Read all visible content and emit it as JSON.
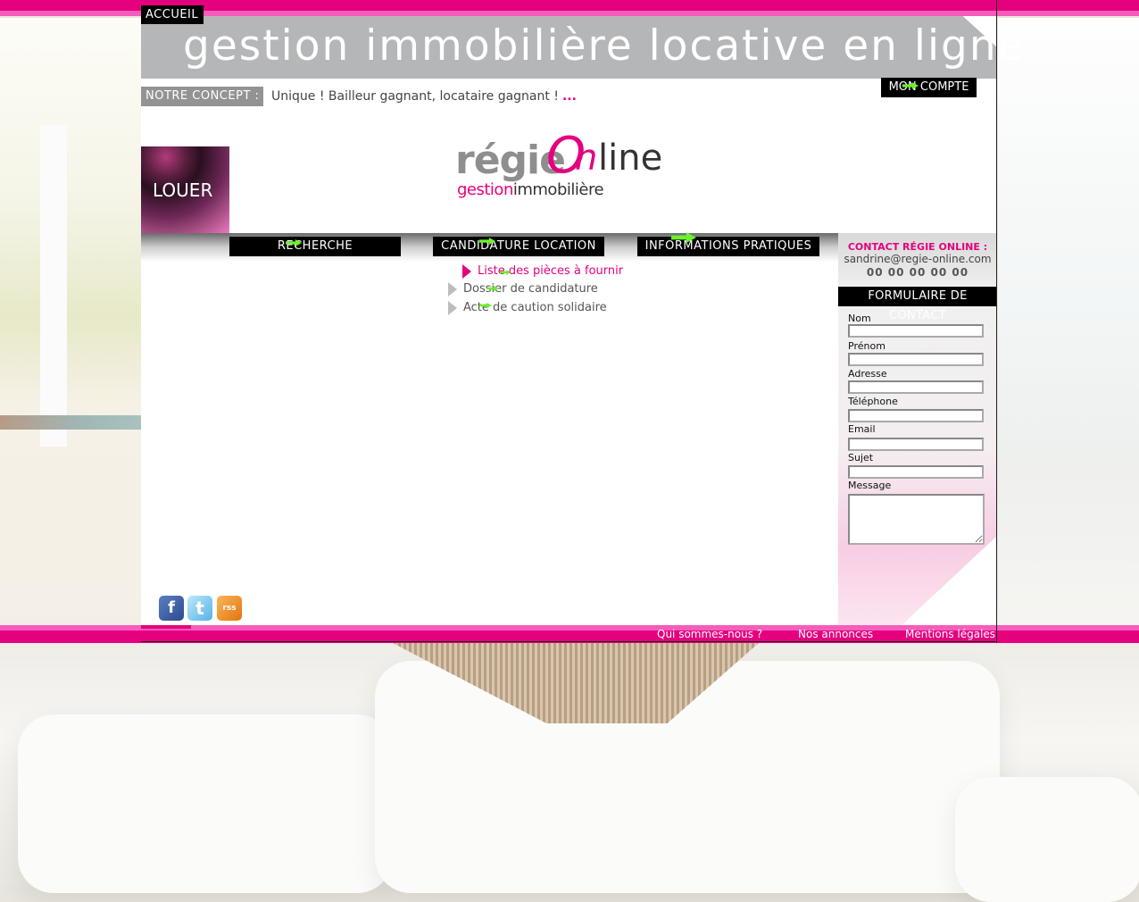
{
  "header": {
    "accueil": "ACCUEIL",
    "banner": "gestion immobilière locative en ligne",
    "mon_compte": "MON COMPTE",
    "concept_label": "NOTRE CONCEPT :",
    "concept_text": "Unique ! Bailleur gagnant, locataire gagnant !",
    "concept_more": "..."
  },
  "logo": {
    "regie": "régie",
    "at": "O",
    "n": "n",
    "line": "line",
    "gestion": "gestion",
    "immobiliere": "immobilière"
  },
  "louer": "LOUER",
  "nav": {
    "items": [
      {
        "label": "RECHERCHE"
      },
      {
        "label": "CANDIDATURE LOCATION"
      },
      {
        "label": "INFORMATIONS PRATIQUES"
      }
    ]
  },
  "submenu": {
    "items": [
      {
        "label": "Liste des pièces à fournir",
        "active": true
      },
      {
        "label": "Dossier de candidature",
        "active": false
      },
      {
        "label": "Acte de caution solidaire",
        "active": false
      }
    ]
  },
  "contact": {
    "title": "CONTACT RÉGIE ONLINE :",
    "email": "sandrine@regie-online.com",
    "phone": "00 00 00 00 00"
  },
  "form": {
    "title": "FORMULAIRE DE CONTACT",
    "fields": {
      "nom": "Nom",
      "prenom": "Prénom",
      "adresse": "Adresse",
      "telephone": "Téléphone",
      "email": "Email",
      "sujet": "Sujet",
      "message": "Message"
    }
  },
  "social": {
    "facebook": "f",
    "twitter": "t",
    "rss": "rss"
  },
  "footer": {
    "links": [
      "Qui sommes-nous ?",
      "Nos annonces",
      "Mentions légales"
    ]
  },
  "colors": {
    "brand_pink": "#e5007e",
    "light_pink": "#f55cbb",
    "nav_black": "#000000",
    "arrow_green": "#6cf22a",
    "banner_grey": "#b5b6b8"
  }
}
